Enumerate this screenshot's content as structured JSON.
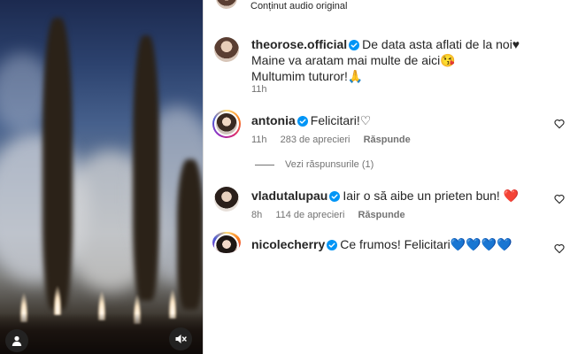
{
  "post": {
    "audio_label": "Conținut audio original"
  },
  "caption": {
    "username": "theorose.official",
    "lines": [
      "De data asta aflati de la noi♥",
      "Maine va aratam mai multe de aici😘",
      "Multumim tuturor!🙏"
    ],
    "time": "11h"
  },
  "comments": [
    {
      "username": "antonia",
      "text": "Felicitari!♡",
      "time": "11h",
      "likes": "283 de aprecieri",
      "reply_label": "Răspunde",
      "view_replies": "Vezi răspunsurile (1)"
    },
    {
      "username": "vladutalupau",
      "text": "Iair o să aibe un prieten bun! ❤️",
      "time": "8h",
      "likes": "114 de aprecieri",
      "reply_label": "Răspunde"
    },
    {
      "username": "nicolecherry",
      "text": "Ce frumos! Felicitari💙💙💙💙"
    }
  ],
  "icons": {
    "verified": "verified-badge-icon",
    "like": "heart-outline-icon",
    "mute": "speaker-muted-icon",
    "tags": "user-tag-icon"
  },
  "colors": {
    "verified": "#0095f6",
    "meta_text": "#737373",
    "text": "#262626",
    "divider": "#dbdbdb",
    "red_heart": "#ed1c2e",
    "blue_heart": "#1d7af2"
  }
}
